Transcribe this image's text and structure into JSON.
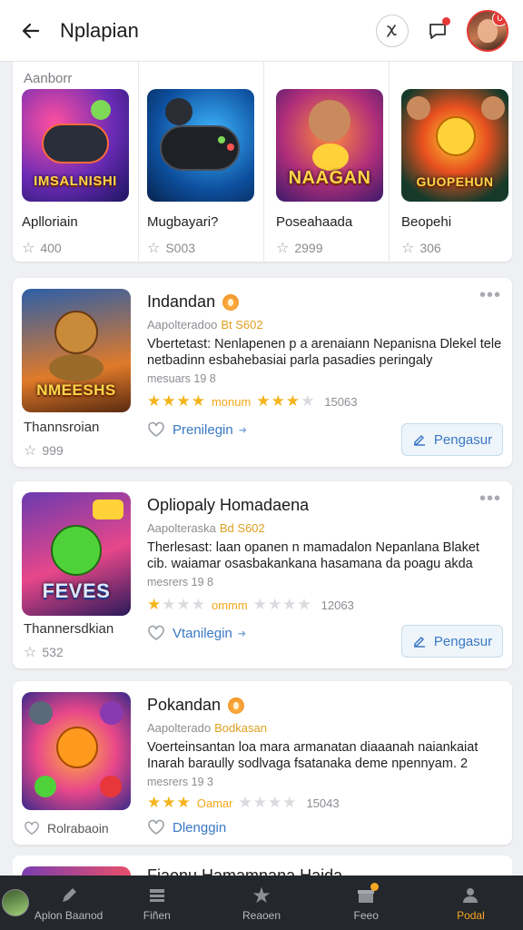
{
  "header": {
    "title": "Nplapian",
    "avatar_badge": "0"
  },
  "featured": {
    "label": "Aanborr",
    "items": [
      {
        "name": "Aplloriain",
        "rating": "400",
        "art_text": "IMSALNISHI"
      },
      {
        "name": "Mugbayari?",
        "rating": "S003",
        "art_text": ""
      },
      {
        "name": "Poseahaada",
        "rating": "2999",
        "art_text": "NAAGAN"
      },
      {
        "name": "Beopehi",
        "rating": "306",
        "art_text": "GUOPEHUN"
      }
    ]
  },
  "cards": [
    {
      "title": "Indandan",
      "developer": "Aapolteradoo",
      "dev_tag": "Bt S602",
      "description": "Vbertetast: Nenlapenen p a arenaiann Nepanisna Dlekel tele netbadinn esbahebasiai parla pasadies peringaly",
      "meta": "mesuars 19 8",
      "stars_filled": 4,
      "stars_half_tail": 3,
      "rating_text": "monum",
      "rating_count": "15063",
      "like_label": "Prenilegin",
      "action_label": "Pengasur",
      "side_title": "Thannsroian",
      "side_rating": "999",
      "art_text": "NMEESHS"
    },
    {
      "title": "Opliopaly Homadaena",
      "developer": "Aapolteraska",
      "dev_tag": "Bd S602",
      "description": "Therlesast: laan opanen n mamadalon Nepanlana Blaket cib. waiamar osasbakankana hasamana da poagu akda",
      "meta": "mesrers 19 8",
      "stars_filled": 1,
      "stars_half_tail": 0,
      "rating_text": "ommm",
      "rating_count": "12063",
      "like_label": "Vtanilegin",
      "action_label": "Pengasur",
      "side_title": "Thannersdkian",
      "side_rating": "532",
      "art_text": "FEVES"
    },
    {
      "title": "Pokandan",
      "developer": "Aapolterado",
      "dev_tag": "Bodkasan",
      "description": "Voerteinsantan loa mara armanatan diaaanah naiankaiat Inarah baraully sodlvaga fsatanaka deme npennyam. 2",
      "meta": "mesrers 19 3",
      "stars_filled": 3,
      "stars_half_tail": 0,
      "rating_text": "Oamar",
      "rating_count": "15043",
      "like_label": "Dlenggin",
      "action_label": "",
      "side_title": "Rolrabaoin",
      "side_rating": "",
      "art_text": ""
    }
  ],
  "partial_card": {
    "title": "Fiaonu Hamamnana Haida"
  },
  "bottom_nav": [
    {
      "label": "Aplon Baanod",
      "icon": "pencil-icon"
    },
    {
      "label": "Fiñen",
      "icon": "list-icon"
    },
    {
      "label": "Reaoen",
      "icon": "star-icon"
    },
    {
      "label": "Feeo",
      "icon": "gift-icon"
    },
    {
      "label": "Podal",
      "icon": "user-icon",
      "active": true
    }
  ],
  "colors": {
    "accent_blue": "#3a78c4",
    "star_gold": "#f4b41a",
    "alert_red": "#e53935",
    "nav_active": "#f5a623"
  }
}
